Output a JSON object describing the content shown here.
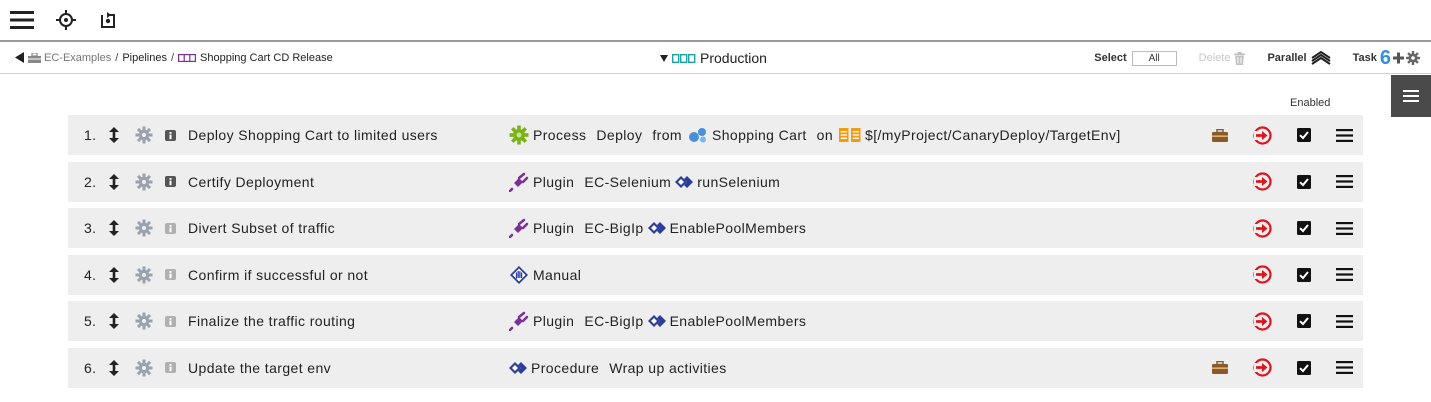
{
  "toolbar": {
    "icons": [
      "menu-icon",
      "crosshair-icon",
      "refresh-icon"
    ]
  },
  "breadcrumb": {
    "project": "EC-Examples",
    "sep1": "/",
    "pipelines": "Pipelines",
    "sep2": "/",
    "pipeline": "Shopping Cart CD Release"
  },
  "stage": {
    "name": "Production"
  },
  "actions": {
    "select_label": "Select",
    "select_value": "All",
    "delete_label": "Delete",
    "parallel_label": "Parallel",
    "task_label": "Task",
    "task_count": "6"
  },
  "table": {
    "enabled_label": "Enabled"
  },
  "colors": {
    "accent": "#2f8fe0",
    "exit": "#e0141e",
    "process": "#7ab317",
    "plugin": "#7a2f9a",
    "procedure": "#2c3e9a",
    "briefcase": "#8a5a2b"
  },
  "tasks": [
    {
      "num": "1.",
      "name": "Deploy Shopping Cart to limited users",
      "info_active": true,
      "detail": {
        "type_icon": "process-icon",
        "type": "Process",
        "part1": "Deploy",
        "word_from": "from",
        "app": "Shopping Cart",
        "word_on": "on",
        "env": "$[/myProject/CanaryDeploy/TargetEnv]"
      },
      "has_briefcase": true,
      "enabled": true
    },
    {
      "num": "2.",
      "name": "Certify Deployment",
      "info_active": true,
      "detail": {
        "type_icon": "plugin-icon",
        "type": "Plugin",
        "plugin": "EC-Selenium",
        "procedure": "runSelenium"
      },
      "has_briefcase": false,
      "enabled": true
    },
    {
      "num": "3.",
      "name": "Divert Subset of traffic",
      "info_active": false,
      "detail": {
        "type_icon": "plugin-icon",
        "type": "Plugin",
        "plugin": "EC-BigIp",
        "procedure": "EnablePoolMembers"
      },
      "has_briefcase": false,
      "enabled": true
    },
    {
      "num": "4.",
      "name": "Confirm if successful or not",
      "info_active": false,
      "detail": {
        "type_icon": "manual-icon",
        "type": "Manual"
      },
      "has_briefcase": false,
      "enabled": true
    },
    {
      "num": "5.",
      "name": "Finalize the traffic routing",
      "info_active": false,
      "detail": {
        "type_icon": "plugin-icon",
        "type": "Plugin",
        "plugin": "EC-BigIp",
        "procedure": "EnablePoolMembers"
      },
      "has_briefcase": false,
      "enabled": true
    },
    {
      "num": "6.",
      "name": "Update the target env",
      "info_active": false,
      "detail": {
        "type_icon": "procedure-icon",
        "type": "Procedure",
        "procedure_name": "Wrap up activities"
      },
      "has_briefcase": true,
      "enabled": true
    }
  ]
}
